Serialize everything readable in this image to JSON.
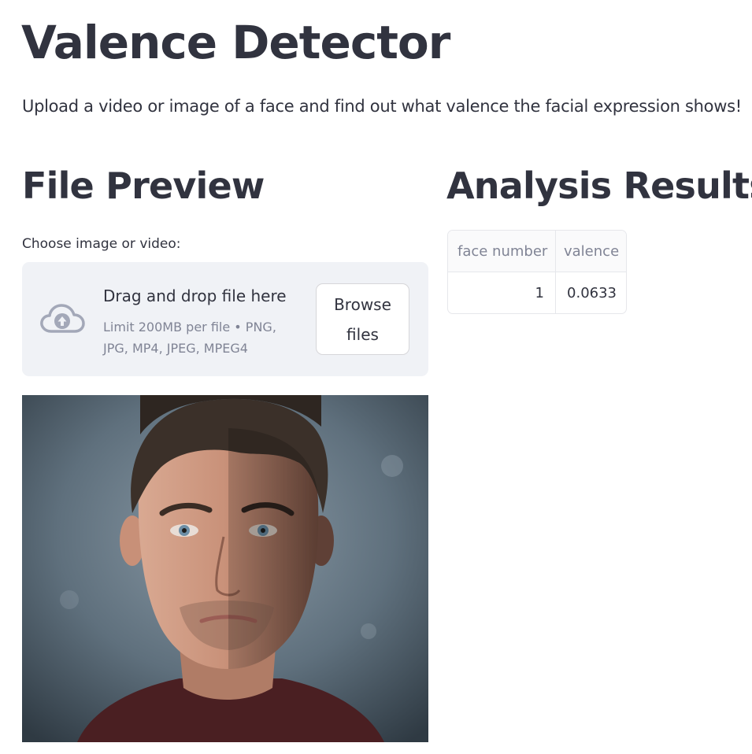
{
  "page": {
    "title": "Valence Detector",
    "intro": "Upload a video or image of a face and find out what valence the facial expression shows!"
  },
  "file_preview": {
    "heading": "File Preview",
    "uploader": {
      "label": "Choose image or video:",
      "drop_title": "Drag and drop file here",
      "limit_text": "Limit 200MB per file • PNG, JPG, MP4, JPEG, MPEG4",
      "browse_label": "Browse files",
      "icon": "cloud-upload-icon"
    },
    "preview_image": {
      "description": "face-portrait"
    }
  },
  "analysis": {
    "heading": "Analysis Results",
    "table": {
      "columns": [
        "face number",
        "valence"
      ],
      "rows": [
        [
          "1",
          "0.0633"
        ]
      ]
    }
  },
  "colors": {
    "text": "#31333f",
    "muted": "#808495",
    "dropzone_bg": "#f0f2f6",
    "cloud_icon": "#a3a8b8"
  }
}
